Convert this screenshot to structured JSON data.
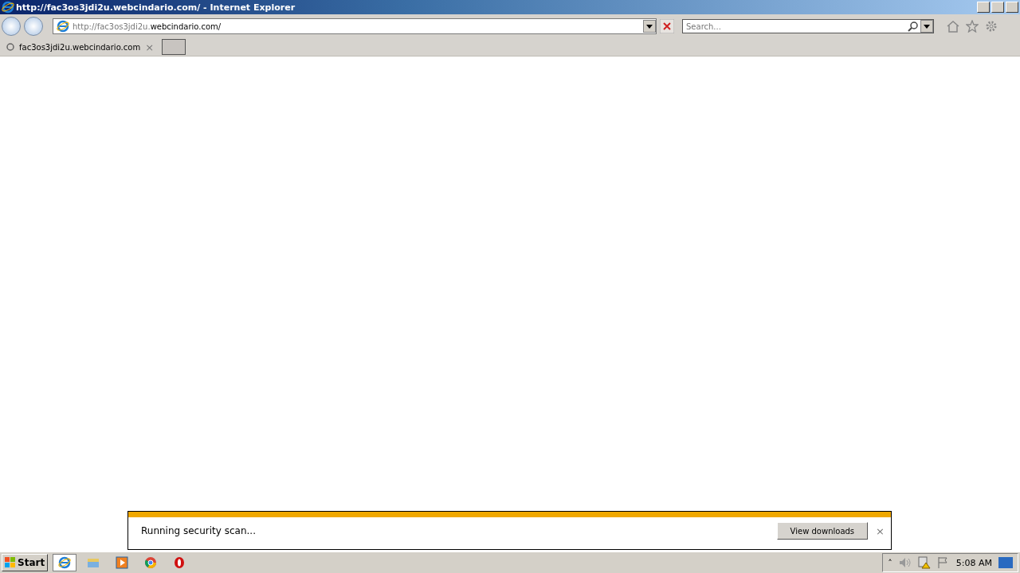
{
  "window": {
    "title": "http://fac3os3jdi2u.webcindario.com/ - Internet Explorer"
  },
  "address_bar": {
    "prefix": "http://fac3os3jdi2u.",
    "domain": "webcindario.com/"
  },
  "search": {
    "placeholder": "Search..."
  },
  "tabs": [
    {
      "label": "fac3os3jdi2u.webcindario.com",
      "close": "×",
      "selected": true
    }
  ],
  "download_bar": {
    "message": "Running security scan...",
    "level": 1,
    "button": "View downloads",
    "close": "×"
  },
  "taskbar": {
    "start": "Start",
    "apps": [
      {
        "kind": "ie",
        "selected": true
      },
      {
        "kind": "explorer",
        "selected": false
      },
      {
        "kind": "media",
        "selected": false
      },
      {
        "kind": "chrome",
        "selected": false
      },
      {
        "kind": "opera",
        "selected": false
      }
    ],
    "tray_arrow": "˄",
    "clock": "5:08 AM"
  }
}
